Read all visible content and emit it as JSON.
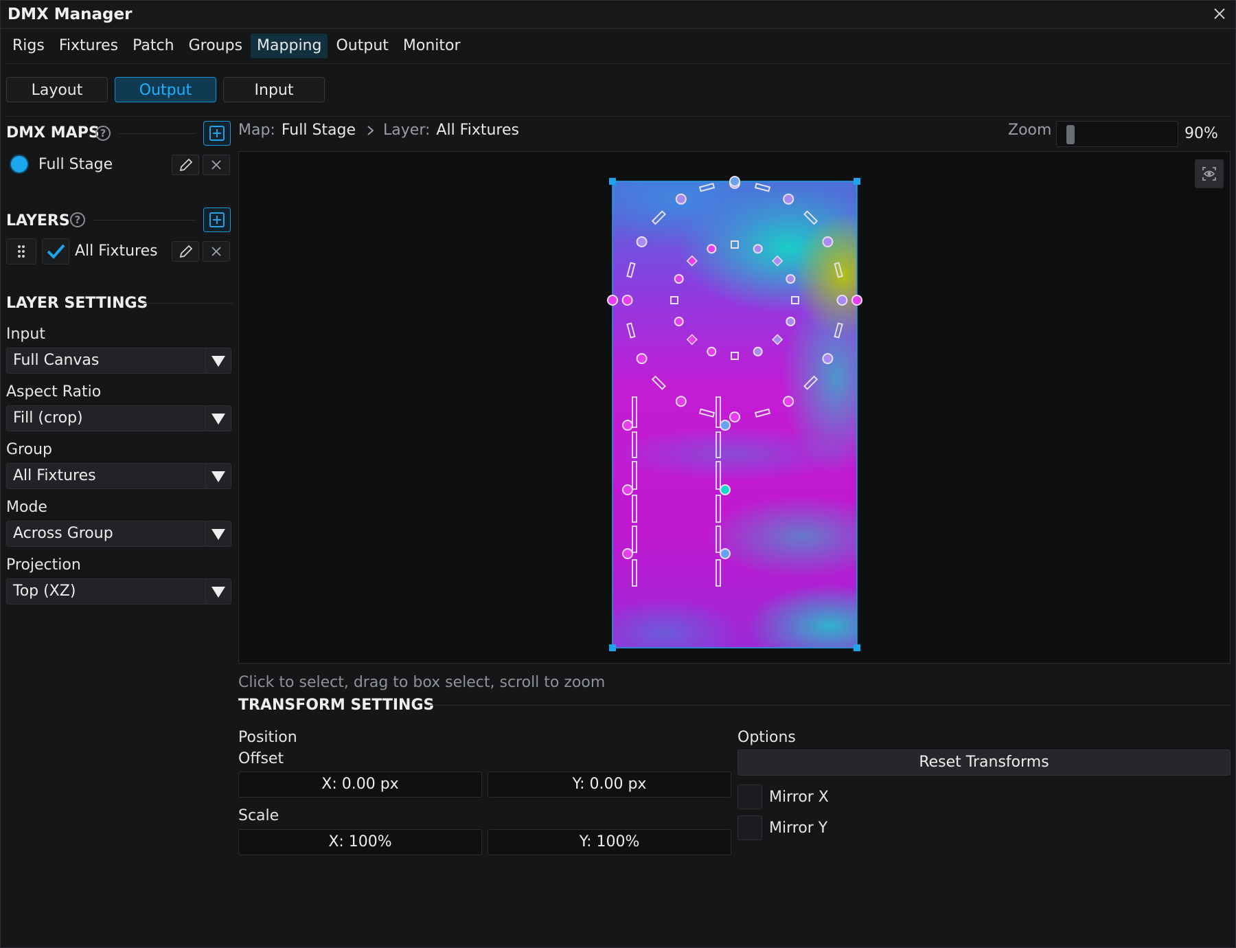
{
  "window": {
    "title": "DMX Manager"
  },
  "tabs": [
    {
      "label": "Rigs",
      "active": false
    },
    {
      "label": "Fixtures",
      "active": false
    },
    {
      "label": "Patch",
      "active": false
    },
    {
      "label": "Groups",
      "active": false
    },
    {
      "label": "Mapping",
      "active": true
    },
    {
      "label": "Output",
      "active": false
    },
    {
      "label": "Monitor",
      "active": false
    }
  ],
  "subtabs": [
    {
      "label": "Layout",
      "active": false
    },
    {
      "label": "Output",
      "active": true
    },
    {
      "label": "Input",
      "active": false
    }
  ],
  "dmx_maps": {
    "heading": "DMX MAPS",
    "help_glyph": "?",
    "items": [
      {
        "name": "Full Stage",
        "color": "#1aa7ec"
      }
    ]
  },
  "layers": {
    "heading": "LAYERS",
    "help_glyph": "?",
    "items": [
      {
        "name": "All Fixtures",
        "checked": true
      }
    ]
  },
  "layer_settings": {
    "heading": "LAYER SETTINGS",
    "fields": [
      {
        "label": "Input",
        "value": "Full Canvas"
      },
      {
        "label": "Aspect Ratio",
        "value": "Fill (crop)"
      },
      {
        "label": "Group",
        "value": "All Fixtures"
      },
      {
        "label": "Mode",
        "value": "Across Group"
      },
      {
        "label": "Projection",
        "value": "Top (XZ)"
      }
    ]
  },
  "breadcrumb": {
    "map_label": "Map:",
    "map_value": "Full Stage",
    "layer_label": "Layer:",
    "layer_value": "All Fixtures"
  },
  "zoom": {
    "label": "Zoom",
    "value": "90%",
    "level": 0.9
  },
  "hint": "Click to select, drag to box select, scroll to zoom",
  "transform": {
    "heading": "TRANSFORM SETTINGS",
    "position_label": "Position",
    "offset_label": "Offset",
    "offset_x": "X: 0.00 px",
    "offset_y": "Y: 0.00 px",
    "scale_label": "Scale",
    "scale_x": "X: 100%",
    "scale_y": "Y: 100%",
    "options_label": "Options",
    "reset_label": "Reset Transforms",
    "mirror_x": {
      "label": "Mirror X",
      "checked": false
    },
    "mirror_y": {
      "label": "Mirror Y",
      "checked": false
    }
  },
  "colors": {
    "accent": "#1ea4ec",
    "active_tab_bg": "#12313f",
    "fixture_magenta": "#e83cf0",
    "fixture_violet": "#a98af0",
    "fixture_blue": "#6aa2f2",
    "fixture_cyan": "#19d8d0"
  },
  "icons": [
    "close-icon",
    "help-icon",
    "add-icon",
    "edit-icon",
    "delete-icon",
    "drag-handle-icon",
    "checkmark-icon",
    "dropdown-arrow-icon",
    "chevron-right-icon",
    "view-toggle-icon"
  ]
}
